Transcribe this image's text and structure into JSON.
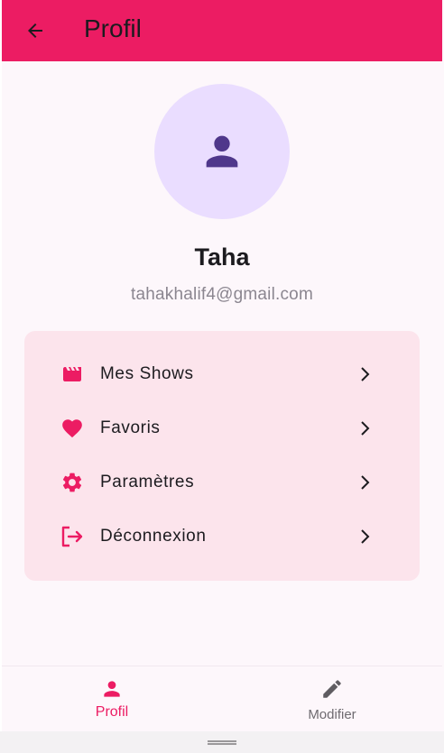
{
  "appbar": {
    "title": "Profil",
    "back_icon": "arrow-back-icon"
  },
  "profile": {
    "avatar_icon": "person-icon",
    "name": "Taha",
    "email": "tahakhalif4@gmail.com"
  },
  "menu": {
    "items": [
      {
        "label": "Mes Shows",
        "icon": "movie-icon"
      },
      {
        "label": "Favoris",
        "icon": "heart-icon"
      },
      {
        "label": "Paramètres",
        "icon": "settings-gear-icon"
      },
      {
        "label": "Déconnexion",
        "icon": "logout-icon"
      }
    ]
  },
  "bottom_nav": {
    "items": [
      {
        "label": "Profil",
        "icon": "person-icon",
        "active": true
      },
      {
        "label": "Modifier",
        "icon": "edit-pencil-icon",
        "active": false
      }
    ]
  },
  "colors": {
    "primary": "#ec1c63",
    "avatar_bg": "#eaddff",
    "avatar_icon": "#4f378b",
    "card_bg": "#fce4ec",
    "background": "#fdf7fb"
  }
}
